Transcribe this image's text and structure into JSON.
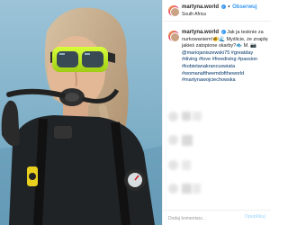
{
  "post": {
    "username": "martyna.world",
    "follow_label": "Obserwuj",
    "location": "South Africa",
    "caption_parts": [
      {
        "t": "text",
        "v": "Jak ja tesknie za "
      },
      {
        "t": "text",
        "v": "nurkowaniem!🐠🌊 Myślicie, że "
      },
      {
        "t": "text",
        "v": "znajdę jakieś zatopione skarby?🐟"
      },
      {
        "t": "text",
        "v": "M. "
      },
      {
        "t": "mention",
        "v": "📷 @mariojaniszewski75"
      },
      {
        "t": "tag",
        "v": "#greatday #diving #love #freediving"
      },
      {
        "t": "tag",
        "v": "#passion #kobietanakrancuswiata"
      },
      {
        "t": "tag",
        "v": "#womanaftheemdoftheworld"
      },
      {
        "t": "tag",
        "v": "#martynawojciechowska"
      }
    ]
  },
  "comment": {
    "placeholder": "Dodaj komentarz...",
    "post_label": "Opublikuj"
  },
  "colors": {
    "link": "#3897f0",
    "hashtag": "#003569",
    "ocean": "#8fb9cf"
  },
  "icons": {
    "verified": "verified-badge-icon"
  }
}
